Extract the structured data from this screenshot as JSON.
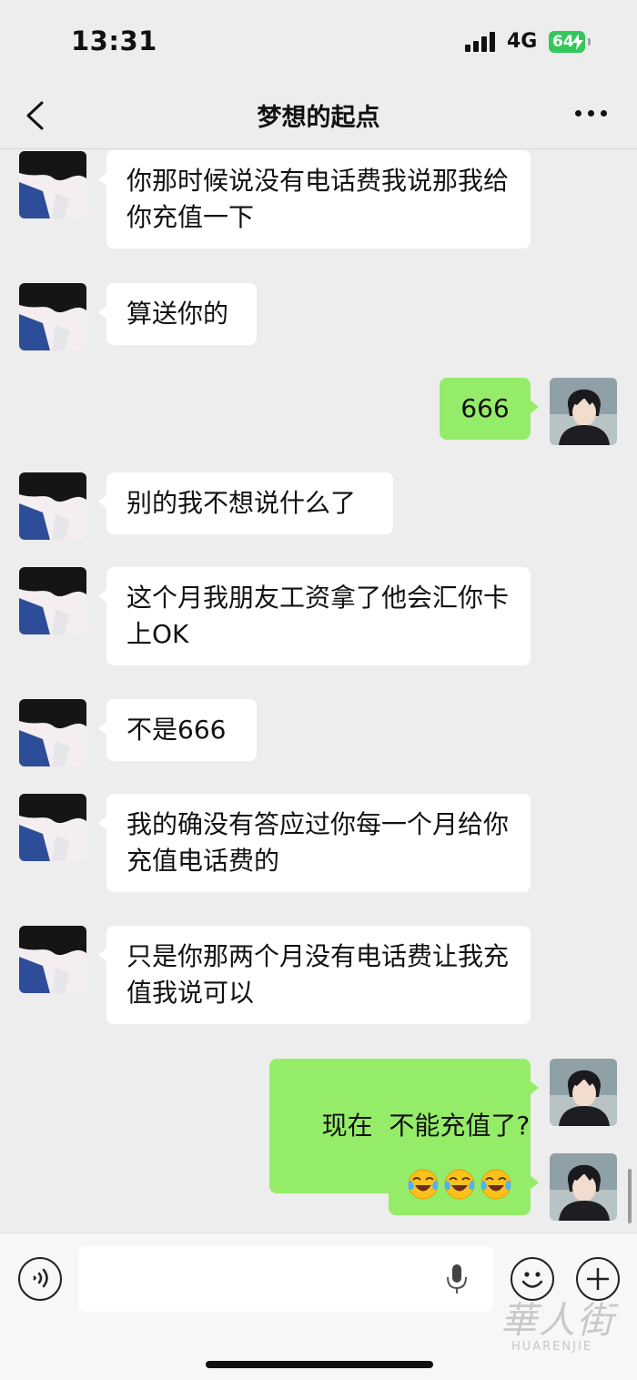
{
  "status_bar": {
    "time": "13:31",
    "network": "4G",
    "battery": "64"
  },
  "nav": {
    "title": "梦想的起点"
  },
  "messages": [
    {
      "from": "other",
      "text": "你那时候说没有电话费我说那我给你充值一下"
    },
    {
      "from": "other",
      "text": "算送你的"
    },
    {
      "from": "me",
      "text": "666"
    },
    {
      "from": "other",
      "text": "别的我不想说什么了"
    },
    {
      "from": "other",
      "text": "这个月我朋友工资拿了他会汇你卡上OK"
    },
    {
      "from": "other",
      "text": "不是666"
    },
    {
      "from": "other",
      "text": "我的确没有答应过你每一个月给你充值电话费的"
    },
    {
      "from": "other",
      "text": "只是你那两个月没有电话费让我充值我说可以"
    },
    {
      "from": "me",
      "text": "现在  不能充值了?"
    },
    {
      "from": "me",
      "emoji": [
        "laugh-crying-emoji",
        "laugh-crying-emoji",
        "laugh-crying-emoji"
      ]
    }
  ],
  "input": {
    "value": "",
    "placeholder": ""
  },
  "watermark": {
    "text": "華人街",
    "sub": "HUARENJIE"
  }
}
